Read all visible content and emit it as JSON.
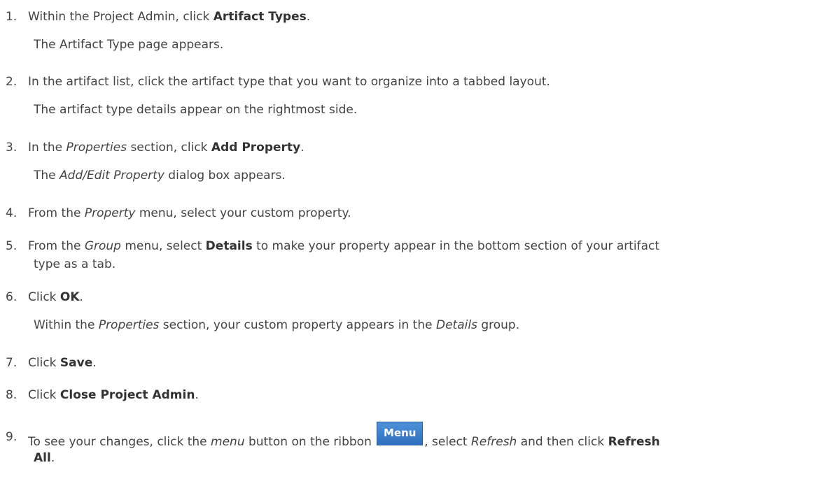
{
  "steps": [
    {
      "num": "1.",
      "a": "Within the Project Admin, click ",
      "b": "Artifact Types",
      "c": ".",
      "result": "The Artifact Type page appears."
    },
    {
      "num": "2.",
      "a": "In the artifact list, click the artifact type that you want to organize into a tabbed layout.",
      "result": "The artifact type details appear on the rightmost side."
    },
    {
      "num": "3.",
      "a": "In the ",
      "i": "Properties",
      "b_pre": " section, click ",
      "b": "Add Property",
      "c": ".",
      "result_i": "Add/Edit Property",
      "result_rest": " dialog box appears.",
      "result_pre": "The "
    },
    {
      "num": "4.",
      "a": "From the ",
      "i": "Property",
      "c": " menu, select your custom property."
    },
    {
      "num": "5.",
      "a": "From the ",
      "i": "Group",
      "b_pre": " menu, select ",
      "b": "Details",
      "c": " to make your property appear in the bottom section of your artifact",
      "line2": "type as a tab."
    },
    {
      "num": "6.",
      "a": " Click ",
      "b": "OK",
      "c": ".",
      "result_pre": "Within the ",
      "result_i": "Properties",
      "result_mid": " section, your custom property appears in the ",
      "result_i2": "Details",
      "result_rest": " group."
    },
    {
      "num": "7.",
      "a": "Click ",
      "b": "Save",
      "c": "."
    },
    {
      "num": "8.",
      "a": "Click ",
      "b": "Close Project Admin",
      "c": "."
    },
    {
      "num": "9.",
      "a": "To see your changes, click the ",
      "i": "menu",
      "b_pre": " button on the ribbon ",
      "button": "Menu",
      "c_pre": ", select ",
      "i2": "Refresh",
      "c": " and then click ",
      "b": "Refresh",
      "line2_b": "All",
      "line2_c": "."
    }
  ]
}
